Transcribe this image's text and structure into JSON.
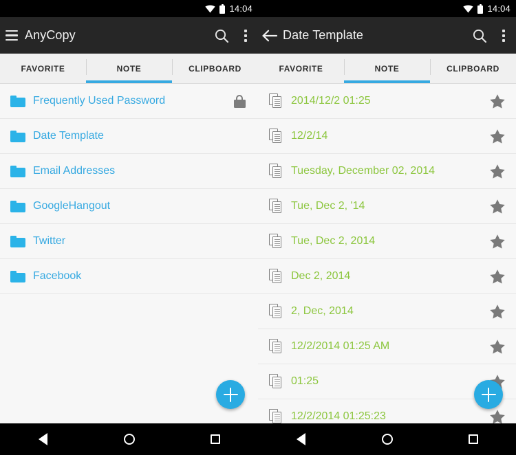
{
  "statusbar": {
    "time": "14:04",
    "icons": [
      "wifi-icon",
      "battery-icon"
    ]
  },
  "colors": {
    "accent_blue": "#29abe2",
    "folder_blue": "#2bb3e8",
    "note_green": "#8cc63e",
    "appbar_dark": "#262626",
    "tabbar_bg": "#f0f0f0",
    "list_bg": "#f7f7f7"
  },
  "left_screen": {
    "appbar": {
      "menu_icon": "hamburger-icon",
      "title": "AnyCopy",
      "search_icon": "search-icon",
      "overflow_icon": "overflow-menu-icon"
    },
    "tabs": [
      {
        "label": "FAVORITE",
        "active": false
      },
      {
        "label": "NOTE",
        "active": true
      },
      {
        "label": "CLIPBOARD",
        "active": false
      }
    ],
    "list": [
      {
        "label": "Frequently Used Password",
        "icon": "folder-icon",
        "trailing": "lock-icon"
      },
      {
        "label": "Date Template",
        "icon": "folder-icon",
        "trailing": ""
      },
      {
        "label": "Email Addresses",
        "icon": "folder-icon",
        "trailing": ""
      },
      {
        "label": "GoogleHangout",
        "icon": "folder-icon",
        "trailing": ""
      },
      {
        "label": "Twitter",
        "icon": "folder-icon",
        "trailing": ""
      },
      {
        "label": "Facebook",
        "icon": "folder-icon",
        "trailing": ""
      }
    ],
    "fab": {
      "icon": "plus-icon",
      "label": "Add"
    }
  },
  "right_screen": {
    "appbar": {
      "back_icon": "back-arrow-icon",
      "title": "Date Template",
      "search_icon": "search-icon",
      "overflow_icon": "overflow-menu-icon"
    },
    "tabs": [
      {
        "label": "FAVORITE",
        "active": false
      },
      {
        "label": "NOTE",
        "active": true
      },
      {
        "label": "CLIPBOARD",
        "active": false
      }
    ],
    "list": [
      {
        "label": "2014/12/2 01:25",
        "icon": "copy-document-icon",
        "trailing": "star-icon"
      },
      {
        "label": "12/2/14",
        "icon": "copy-document-icon",
        "trailing": "star-icon"
      },
      {
        "label": "Tuesday, December 02, 2014",
        "icon": "copy-document-icon",
        "trailing": "star-icon"
      },
      {
        "label": "Tue, Dec 2, '14",
        "icon": "copy-document-icon",
        "trailing": "star-icon"
      },
      {
        "label": "Tue, Dec 2, 2014",
        "icon": "copy-document-icon",
        "trailing": "star-icon"
      },
      {
        "label": "Dec 2, 2014",
        "icon": "copy-document-icon",
        "trailing": "star-icon"
      },
      {
        "label": "2, Dec, 2014",
        "icon": "copy-document-icon",
        "trailing": "star-icon"
      },
      {
        "label": "12/2/2014 01:25 AM",
        "icon": "copy-document-icon",
        "trailing": "star-icon"
      },
      {
        "label": "01:25",
        "icon": "copy-document-icon",
        "trailing": "star-icon"
      },
      {
        "label": "12/2/2014 01:25:23",
        "icon": "copy-document-icon",
        "trailing": "star-icon"
      }
    ],
    "fab": {
      "icon": "plus-icon",
      "label": "Add"
    }
  },
  "navbar": {
    "back": "back-triangle-icon",
    "home": "home-circle-icon",
    "recents": "recents-square-icon"
  }
}
